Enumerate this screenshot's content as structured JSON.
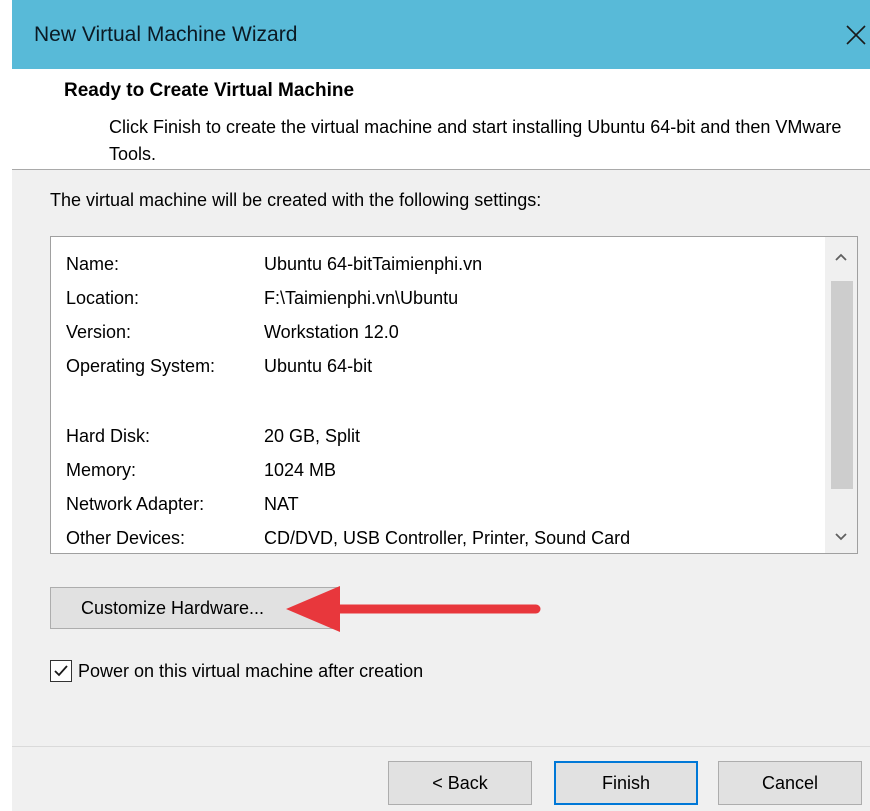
{
  "window": {
    "title": "New Virtual Machine Wizard"
  },
  "header": {
    "title": "Ready to Create Virtual Machine",
    "description": "Click Finish to create the virtual machine and start installing Ubuntu 64-bit and then VMware Tools."
  },
  "main": {
    "intro": "The virtual machine will be created with the following settings:",
    "settings": [
      {
        "label": "Name:",
        "value": "Ubuntu 64-bitTaimienphi.vn"
      },
      {
        "label": "Location:",
        "value": "F:\\Taimienphi.vn\\Ubuntu"
      },
      {
        "label": "Version:",
        "value": "Workstation 12.0"
      },
      {
        "label": "Operating System:",
        "value": "Ubuntu 64-bit"
      },
      {
        "label": "Hard Disk:",
        "value": "20 GB, Split"
      },
      {
        "label": "Memory:",
        "value": "1024 MB"
      },
      {
        "label": "Network Adapter:",
        "value": "NAT"
      },
      {
        "label": "Other Devices:",
        "value": "CD/DVD, USB Controller, Printer, Sound Card"
      }
    ],
    "customize_label": "Customize Hardware...",
    "power_on_label": "Power on this virtual machine after creation",
    "power_on_checked": true
  },
  "footer": {
    "back_label": "< Back",
    "finish_label": "Finish",
    "cancel_label": "Cancel"
  },
  "icons": {
    "close": "close-icon",
    "scroll_up": "chevron-up-icon",
    "scroll_down": "chevron-down-icon",
    "check": "checkmark-icon",
    "annotation": "red-arrow-icon"
  },
  "colors": {
    "titlebar": "#58bad8",
    "annotation_arrow": "#e8373c",
    "default_button_border": "#0078d7"
  }
}
